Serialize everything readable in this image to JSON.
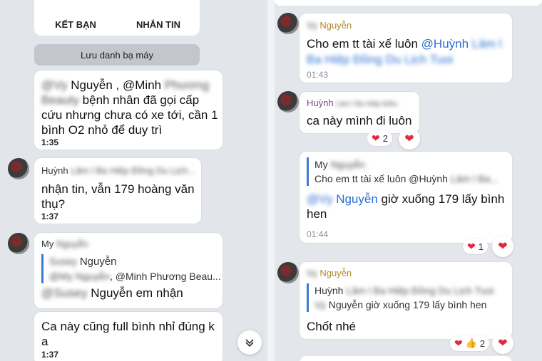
{
  "left": {
    "buttons": {
      "add_friend": "KẾT BẠN",
      "message": "NHẮN TIN"
    },
    "save_contacts": "Lưu danh bạ máy",
    "messages": [
      {
        "mention_line_a": "@Vy Nguyễn",
        "mention_line_b": ", @Minh Phương",
        "mention_blur_2": "Beauty",
        "text_1": "bệnh nhân đã gọi cấp",
        "text_2": "cứu nhưng chưa có xe tới, cần 1",
        "text_3": "bình O2 nhỏ để duy trì",
        "time": "1:35"
      },
      {
        "sender_prefix": "Huỳnh",
        "sender_blur": "Lâm l Ba Hiệp Đồng Du Lịch...",
        "text_1": "nhận tin, vẫn 179 hoàng văn",
        "text_2": "thụ?",
        "time": "1:37"
      },
      {
        "sender_prefix": "My",
        "sender_blur": "Nguyễn",
        "quote_name_blur": "Susey",
        "quote_name": "Nguyễn",
        "quote_mention_1": "@My Nguyễn",
        "quote_mention_2": ", @Minh Phương Beau...",
        "mention_blur": "@Susey",
        "mention_name": "Nguyễn",
        "text": "em nhận"
      },
      {
        "text_1": "Ca này cũng full bình nhỉ đúng k",
        "text_2": "a",
        "time": "1:37"
      }
    ]
  },
  "right": {
    "messages": [
      {
        "sender_blur": "Vy",
        "sender": "Nguyễn",
        "text": "Cho em tt tài xế luôn",
        "mention": "@Huỳnh",
        "mention_blur": "Lâm l",
        "mention_blur_2": "Ba Hiệp Đồng Du Lịch Tuoi",
        "time": "01:43"
      },
      {
        "sender": "Huỳnh",
        "sender_blur": "Lâm l Ba Hiệp Điều",
        "text": "ca này mình đi luôn",
        "reaction_count": "2"
      },
      {
        "quote_sender": "My",
        "quote_sender_blur": "Nguyễn",
        "quote_text": "Cho em tt tài xế luôn @Huỳnh",
        "quote_text_blur": "Lâm l Ba...",
        "mention_blur": "@Vy",
        "mention": "Nguyễn",
        "text_1": "giờ xuống 179 lấy bình",
        "text_2": "hen",
        "time": "01:44",
        "reaction_count": "1"
      },
      {
        "sender_blur": "Vy",
        "sender": "Nguyễn",
        "quote_sender": "Huỳnh",
        "quote_sender_blur": "Lâm l Ba Hiệp Đồng Du Lịch Tuoi",
        "quote_text_blur": "Vy",
        "quote_text": "Nguyễn giờ xuống 179 lấy bình hen",
        "text": "Chốt nhé",
        "reaction_count": "2"
      }
    ]
  }
}
